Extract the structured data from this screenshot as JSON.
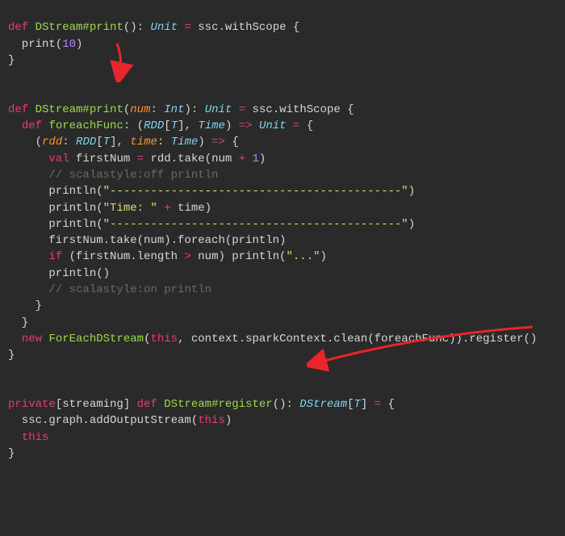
{
  "code": {
    "l01_def": "def",
    "l01_name": "DStream#print",
    "l01_rest1": "(): ",
    "l01_type": "Unit",
    "l01_rest2": " ",
    "l01_op": "=",
    "l01_rest3": " ssc.withScope {",
    "l02_a": "  print(",
    "l02_num": "10",
    "l02_b": ")",
    "l03": "}",
    "l05_def": "def",
    "l05_name": "DStream#print",
    "l05_a": "(",
    "l05_p": "num",
    "l05_b": ": ",
    "l05_t1": "Int",
    "l05_c": "): ",
    "l05_t2": "Unit",
    "l05_d": " ",
    "l05_op": "=",
    "l05_e": " ssc.withScope {",
    "l06_def": "def",
    "l06_name": "foreachFunc",
    "l06_a": ": (",
    "l06_t1": "RDD",
    "l06_b": "[",
    "l06_t2": "T",
    "l06_c": "], ",
    "l06_t3": "Time",
    "l06_d": ") ",
    "l06_op1": "=>",
    "l06_e": " ",
    "l06_t4": "Unit",
    "l06_f": " ",
    "l06_op2": "=",
    "l06_g": " {",
    "l07_a": "    (",
    "l07_p1": "rdd",
    "l07_b": ": ",
    "l07_t1": "RDD",
    "l07_c": "[",
    "l07_t2": "T",
    "l07_d": "], ",
    "l07_p2": "time",
    "l07_e": ": ",
    "l07_t3": "Time",
    "l07_f": ") ",
    "l07_op": "=>",
    "l07_g": " {",
    "l08_val": "val",
    "l08_a": " firstNum ",
    "l08_op1": "=",
    "l08_b": " rdd.take(num ",
    "l08_op2": "+",
    "l08_c": " ",
    "l08_num": "1",
    "l08_d": ")",
    "l09_cmt": "// scalastyle:off println",
    "l10_a": "      println(",
    "l10_str": "\"-------------------------------------------\"",
    "l10_b": ")",
    "l11_a": "      println(",
    "l11_str": "\"Time: \"",
    "l11_b": " ",
    "l11_op": "+",
    "l11_c": " time)",
    "l12_a": "      println(",
    "l12_str": "\"-------------------------------------------\"",
    "l12_b": ")",
    "l13": "      firstNum.take(num).foreach(println)",
    "l14_if": "if",
    "l14_a": " (firstNum.length ",
    "l14_op": ">",
    "l14_b": " num) println(",
    "l14_str": "\"...\"",
    "l14_c": ")",
    "l15": "      println()",
    "l16_cmt": "// scalastyle:on println",
    "l17": "    }",
    "l18": "  }",
    "l19_new": "new",
    "l19_cls": "ForEachDStream",
    "l19_a": "(",
    "l19_this1": "this",
    "l19_b": ", context.sparkContext.clean(foreachFunc)).register()",
    "l20": "}",
    "l23_priv": "private",
    "l23_a": "[streaming] ",
    "l23_def": "def",
    "l23_name": "DStream#register",
    "l23_b": "(): ",
    "l23_t1": "DStream",
    "l23_c": "[",
    "l23_t2": "T",
    "l23_d": "] ",
    "l23_op": "=",
    "l23_e": " {",
    "l24_a": "  ssc.graph.addOutputStream(",
    "l24_this": "this",
    "l24_b": ")",
    "l25_this": "this",
    "l26": "}"
  }
}
